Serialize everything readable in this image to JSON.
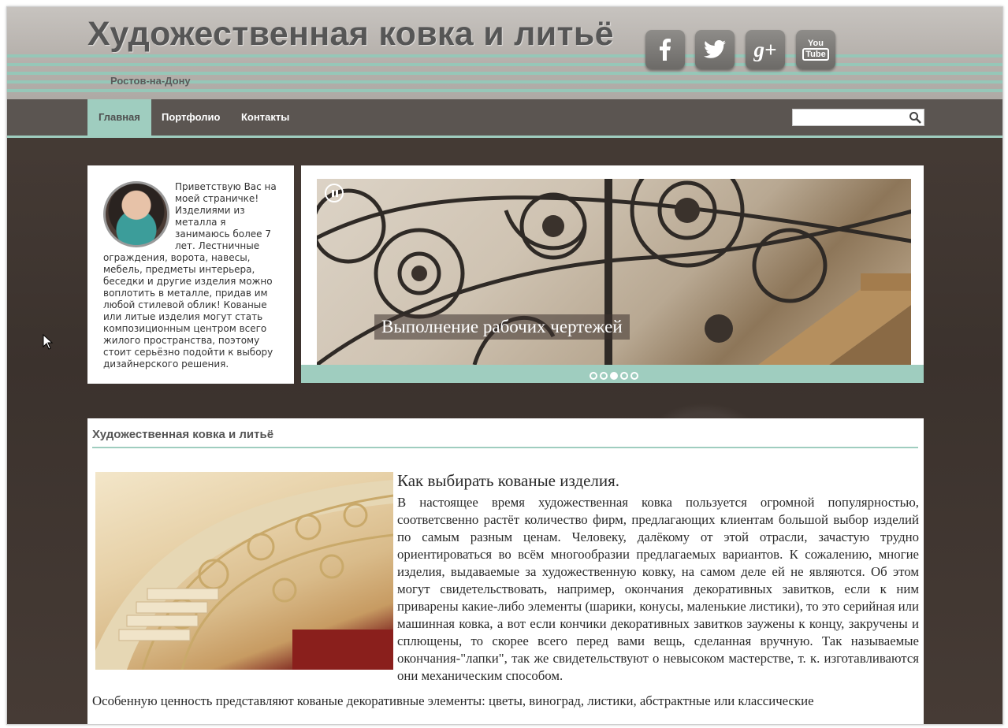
{
  "header": {
    "title": "Художественная ковка и литьё",
    "subtitle": "Ростов-на-Дону",
    "social": [
      {
        "icon": "facebook-icon",
        "glyph": "f"
      },
      {
        "icon": "twitter-icon",
        "glyph": "t"
      },
      {
        "icon": "google-plus-icon",
        "glyph": "g+"
      },
      {
        "icon": "youtube-icon",
        "glyph": "You Tube"
      }
    ]
  },
  "nav": {
    "items": [
      {
        "label": "Главная",
        "active": true
      },
      {
        "label": "Портфолио",
        "active": false
      },
      {
        "label": "Контакты",
        "active": false
      }
    ],
    "search": {
      "placeholder": "",
      "icon": "search-icon"
    }
  },
  "intro": {
    "text": "Приветствую Вас на моей страничке! Изделиями из металла я занимаюсь более 7 лет. Лестничные ограждения, ворота, навесы, мебель, предметы интерьера, беседки и другие изделия можно воплотить в металле, придав им любой стилевой облик! Кованые или литые изделия могут стать композиционным центром всего жилого пространства, поэтому стоит серьёзно подойти к выбору дизайнерского решения."
  },
  "slider": {
    "caption": "Выполнение рабочих чертежей",
    "slide_count": 5,
    "active_slide": 3
  },
  "content": {
    "title": "Художественная ковка и литьё",
    "heading": "Как выбирать кованые изделия.",
    "paragraph1": " В настоящее время художественная ковка пользуется огромной популярностью, соответсвенно растёт количество фирм, предлагающих клиентам большой выбор изделий по самым разным ценам. Человеку, далёкому от этой отрасли, зачастую трудно ориентироваться во всём многообразии предлагаемых вариантов.  К сожалению, многие изделия, выдаваемые за художественную ковку, на самом деле ей не являются. Об этом могут свидетельствовать, например, окончания декоративных завитков, если к ним приварены какие-либо элементы (шарики, конусы, маленькие листики), то это серийная или машинная ковка, а вот если кончики декоративных завитков заужены к концу, закручены и сплющены, то скорее всего перед вами вещь, сделанная вручную. Так называемые окончания-\"лапки\", так же свидетельствуют о невысоком мастерстве, т. к. изготавливаются они механическим способом.",
    "paragraph2": " Особенную ценность представляют кованые декоративные элементы: цветы, виноград, листики, абстрактные или классические"
  }
}
